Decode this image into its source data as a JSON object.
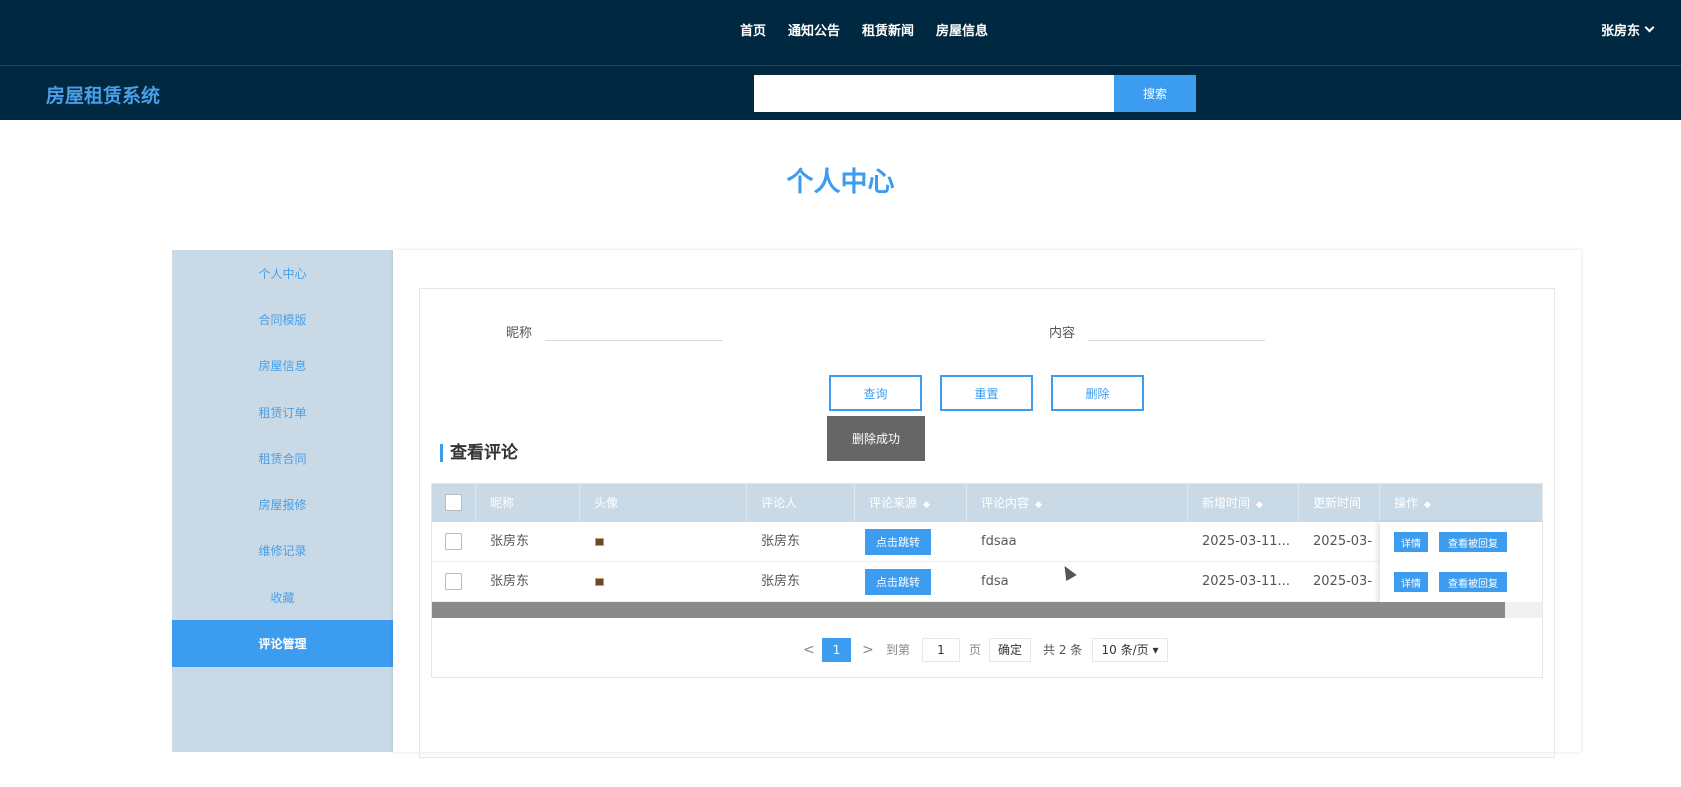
{
  "header": {
    "nav": [
      "首页",
      "通知公告",
      "租赁新闻",
      "房屋信息"
    ],
    "user_name": "张房东",
    "brand": "房屋租赁系统",
    "search_placeholder": "",
    "search_button": "搜索"
  },
  "page_title": "个人中心",
  "sidebar": {
    "items": [
      {
        "label": "个人中心",
        "active": false
      },
      {
        "label": "合同模版",
        "active": false
      },
      {
        "label": "房屋信息",
        "active": false
      },
      {
        "label": "租赁订单",
        "active": false
      },
      {
        "label": "租赁合同",
        "active": false
      },
      {
        "label": "房屋报修",
        "active": false
      },
      {
        "label": "维修记录",
        "active": false
      },
      {
        "label": "收藏",
        "active": false
      },
      {
        "label": "评论管理",
        "active": true
      }
    ]
  },
  "filters": {
    "nickname_label": "昵称",
    "nickname_value": "",
    "content_label": "内容",
    "content_value": "",
    "query_button": "查询",
    "reset_button": "重置",
    "delete_button": "删除"
  },
  "toast": "删除成功",
  "section_title": "查看评论",
  "table": {
    "columns": [
      "昵称",
      "头像",
      "评论人",
      "评论来源",
      "评论内容",
      "新增时间",
      "更新时间",
      "操作"
    ],
    "rows": [
      {
        "nickname": "张房东",
        "commenter": "张房东",
        "source_button": "点击跳转",
        "content": "fdsaa",
        "created": "2025-03-11...",
        "updated": "2025-03-",
        "detail_button": "详情",
        "reply_button": "查看被回复"
      },
      {
        "nickname": "张房东",
        "commenter": "张房东",
        "source_button": "点击跳转",
        "content": "fdsa",
        "created": "2025-03-11...",
        "updated": "2025-03-",
        "detail_button": "详情",
        "reply_button": "查看被回复"
      }
    ]
  },
  "pagination": {
    "prev": "<",
    "current_page": "1",
    "next": ">",
    "goto_label": "到第",
    "goto_value": "1",
    "page_unit": "页",
    "confirm": "确定",
    "total": "共 2 条",
    "page_size": "10 条/页"
  },
  "colors": {
    "header_bg": "#002840",
    "accent": "#3c9df0",
    "sidebar_bg": "#c9dae6"
  }
}
